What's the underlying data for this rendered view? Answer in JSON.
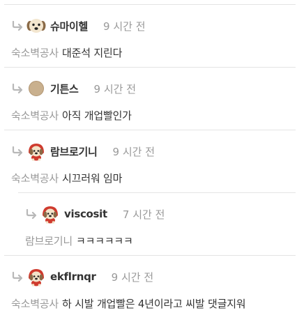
{
  "comments": [
    {
      "author": "슈마이헬",
      "time": "9 시간 전",
      "avatar": "dog-face-icon",
      "reply_to": "숙소벽공사",
      "text": "대준석 지린다"
    },
    {
      "author": "기튼스",
      "time": "9 시간 전",
      "avatar": "round-circle-icon",
      "reply_to": "숙소벽공사",
      "text": "아직 개업빨인가"
    },
    {
      "author": "람브로기니",
      "time": "9 시간 전",
      "avatar": "dog-red-hood-icon",
      "reply_to": "숙소벽공사",
      "text": "시끄러워 임마"
    },
    {
      "author": "viscosit",
      "time": "7 시간 전",
      "avatar": "dog-red-hood-icon",
      "reply_to": "람브로기니",
      "text": "ㅋㅋㅋㅋㅋㅋ"
    },
    {
      "author": "ekflrnqr",
      "time": "9 시간 전",
      "avatar": "dog-red-hood-icon",
      "reply_to": "숙소벽공사",
      "text": "하 시발 개업빨은 4년이라고 씨발 댓글지워"
    }
  ],
  "colors": {
    "author": "#333333",
    "muted": "#999999",
    "divider": "#e4e4e4",
    "reply_arrow": "#b8b8b8"
  }
}
